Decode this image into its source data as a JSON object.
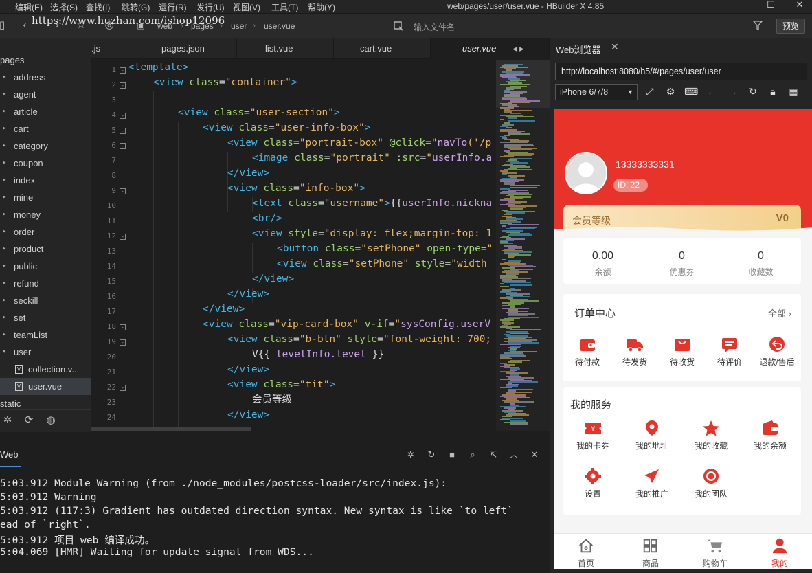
{
  "menu": [
    "编辑(E)",
    "选择(S)",
    "查找(I)",
    "跳转(G)",
    "运行(R)",
    "发行(U)",
    "视图(V)",
    "工具(T)",
    "帮助(Y)"
  ],
  "window": {
    "title": "web/pages/user/user.vue - HBuilder X 4.85"
  },
  "toolbar": {
    "watermark": "https://www.huzhan.com/ishop12096",
    "breadcrumb": [
      "web",
      "pages",
      "user",
      "user.vue"
    ],
    "file_search_placeholder": "输入文件名",
    "preview_label": "预览"
  },
  "sidebar": {
    "items": [
      {
        "label": "pages",
        "type": "root"
      },
      {
        "label": "address",
        "type": "folder"
      },
      {
        "label": "agent",
        "type": "folder"
      },
      {
        "label": "article",
        "type": "folder"
      },
      {
        "label": "cart",
        "type": "folder"
      },
      {
        "label": "category",
        "type": "folder"
      },
      {
        "label": "coupon",
        "type": "folder"
      },
      {
        "label": "index",
        "type": "folder"
      },
      {
        "label": "mine",
        "type": "folder"
      },
      {
        "label": "money",
        "type": "folder"
      },
      {
        "label": "order",
        "type": "folder"
      },
      {
        "label": "product",
        "type": "folder"
      },
      {
        "label": "public",
        "type": "folder"
      },
      {
        "label": "refund",
        "type": "folder"
      },
      {
        "label": "seckill",
        "type": "folder"
      },
      {
        "label": "set",
        "type": "folder"
      },
      {
        "label": "teamList",
        "type": "folder"
      },
      {
        "label": "user",
        "type": "folder-open"
      },
      {
        "label": "collection.v...",
        "type": "file"
      },
      {
        "label": "user.vue",
        "type": "file",
        "selected": true
      },
      {
        "label": "static",
        "type": "root"
      }
    ]
  },
  "tabs": [
    {
      "label": ".js"
    },
    {
      "label": "pages.json"
    },
    {
      "label": "list.vue"
    },
    {
      "label": "cart.vue"
    },
    {
      "label": "user.vue",
      "active": true
    }
  ],
  "editor": {
    "line_numbers": [
      "1",
      "2",
      "3",
      "4",
      "5",
      "6",
      "7",
      "8",
      "9",
      "10",
      "11",
      "12",
      "13",
      "14",
      "15",
      "16",
      "17",
      "18",
      "19",
      "20",
      "21",
      "22",
      "23",
      "24"
    ]
  },
  "console": {
    "tab_label": "Web",
    "lines": [
      "5:03.912 Module Warning (from ./node_modules/postcss-loader/src/index.js):",
      "5:03.912 Warning",
      "5:03.912 (117:3) Gradient has outdated direction syntax. New syntax is like `to left`",
      "ead of `right`.",
      "5:03.912 项目 web 编译成功。",
      "5:04.069 [HMR] Waiting for update signal from WDS..."
    ]
  },
  "browser": {
    "tab_label": "Web浏览器",
    "url": "http://localhost:8080/h5/#/pages/user/user",
    "device": "iPhone 6/7/8"
  },
  "phone": {
    "username": "13333333331",
    "uid": "ID: 22",
    "vip_title": "会员等级",
    "vip_level": "V0",
    "stats": [
      {
        "value": "0.00",
        "label": "余额"
      },
      {
        "value": "0",
        "label": "优惠券"
      },
      {
        "value": "0",
        "label": "收藏数"
      }
    ],
    "order_title": "订单中心",
    "order_more": "全部",
    "order_items": [
      "待付款",
      "待发货",
      "待收货",
      "待评价",
      "退款/售后"
    ],
    "service_title": "我的服务",
    "service_items": [
      "我的卡券",
      "我的地址",
      "我的收藏",
      "我的余额",
      "设置",
      "我的推广",
      "我的团队"
    ],
    "tabbar": [
      {
        "label": "首页"
      },
      {
        "label": "商品"
      },
      {
        "label": "购物车"
      },
      {
        "label": "我的",
        "active": true
      }
    ],
    "accent_color": "#e8332a"
  }
}
